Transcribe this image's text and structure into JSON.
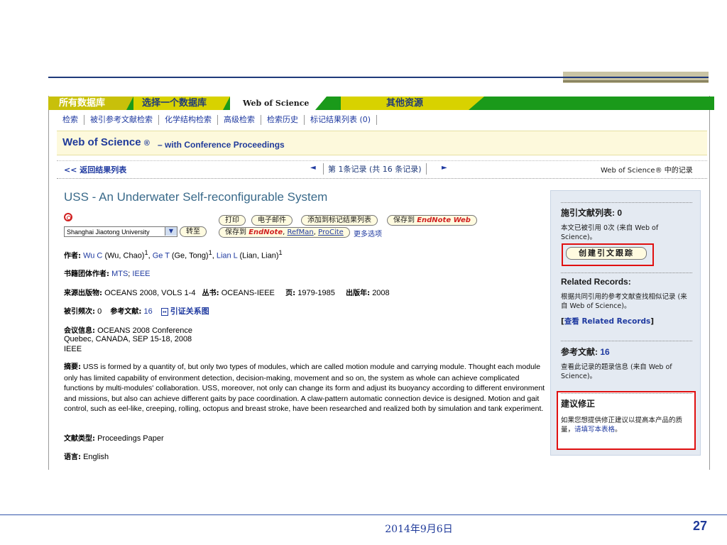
{
  "tabs": {
    "all_db": "所有数据库",
    "select_db": "选择一个数据库",
    "wos": "Web of Science",
    "other": "其他资源"
  },
  "subnav": [
    "检索",
    "被引参考文献检索",
    "化学结构检索",
    "高级检索",
    "检索历史",
    "标记结果列表 (0)"
  ],
  "header": {
    "title": "Web of Science",
    "reg": "®",
    "subtitle": "– with Conference Proceedings"
  },
  "record_nav": {
    "back": "<< 返回结果列表",
    "prev": "◄",
    "position": "第 1条记录 (共 16 条记录)",
    "next": "►",
    "wos_records": "Web of Science® 中的记录"
  },
  "record": {
    "title": "USS - An Underwater Self-reconfigurable System",
    "institution_select": "Shanghai Jiaotong University",
    "goto": "转至",
    "print": "打印",
    "email": "电子邮件",
    "add_to_list": "添加到标记结果列表",
    "save_to": "保存到",
    "endnote_web": "EndNote Web",
    "save_to2": "保存到",
    "endnote": "EndNote",
    "refman": "RefMan",
    "procite": "ProCite",
    "more_options": "更多选项",
    "authors_label": "作者:",
    "author1": "Wu C",
    "author1_full": "(Wu, Chao)",
    "author2": "Ge T",
    "author2_full": "(Ge, Tong)",
    "author3": "Lian L",
    "author3_full": "(Lian, Lian)",
    "sup": "1",
    "group_label": "书籍团体作者:",
    "group1": "MTS",
    "group2": "IEEE",
    "source_label": "来源出版物:",
    "source": "OCEANS 2008, VOLS 1-4",
    "series_label": "丛书:",
    "series": "OCEANS-IEEE",
    "pages_label": "页:",
    "pages": "1979-1985",
    "year_label": "出版年:",
    "year": "2008",
    "cited_label": "被引频次:",
    "cited": "0",
    "refs_label": "参考文献:",
    "refs": "16",
    "citemap": "引证关系图",
    "conf_label": "会议信息:",
    "conf_name": "OCEANS 2008 Conference",
    "conf_place": "Quebec, CANADA, SEP 15-18, 2008",
    "conf_org": "IEEE",
    "abstract_label": "摘要:",
    "abstract": "USS is formed by a quantity of, but only two types of modules, which are called motion module and carrying module. Thought each module only has limited capability of environment detection, decision-making, movement and so on, the system as whole can achieve complicated functions by multi-modules' collaboration. USS, moreover, not only can change its form and adjust its buoyancy according to different environment and missions, but also can achieve different gaits by pace coordination. A claw-pattern automatic connection device is designed. Motion and gait control, such as eel-like, creeping, rolling, octopus and breast stroke, have been researched and realized both by simulation and tank experiment.",
    "doctype_label": "文献类型:",
    "doctype": "Proceedings Paper",
    "lang_label": "语言:",
    "lang": "English"
  },
  "sidebar": {
    "citing_head": "施引文献列表: 0",
    "citing_text": "本文已被引用 0次 (来自 Web of Science)。",
    "create_track": "创建引文跟踪",
    "related_head": "Related Records:",
    "related_text": "根据共同引用的参考文献查找相似记录 (来自 Web of Science)。",
    "related_link_open": "[",
    "related_link": "查看 Related Records",
    "related_link_close": "]",
    "refs_head": "参考文献:",
    "refs_count": "16",
    "refs_text": "查看此记录的题录信息 (来自 Web of Science)。",
    "correct_head": "建议修正",
    "correct_text": "如果您想提供修正建议以提高本产品的质量，",
    "correct_link": "请填写本表格",
    "correct_end": "。"
  },
  "slide": {
    "date": "2014年9月6日",
    "page": "27"
  }
}
